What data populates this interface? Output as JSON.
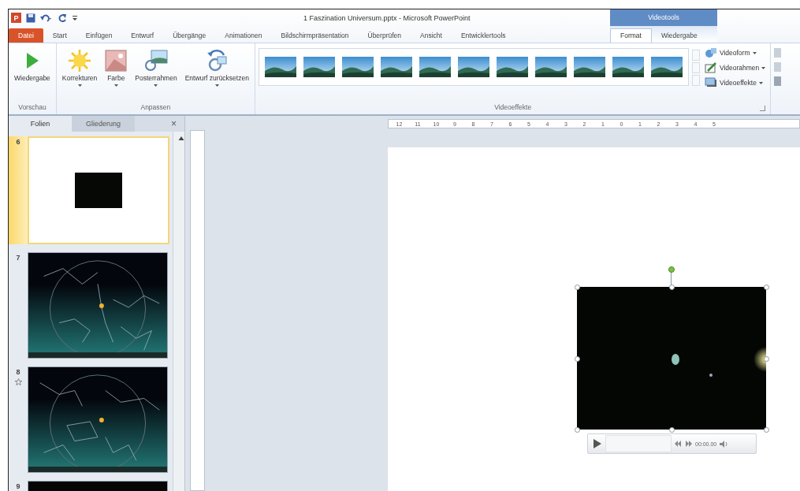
{
  "title_bar": {
    "logo_letter": "P",
    "title": "1 Faszination Universum.pptx - Microsoft PowerPoint",
    "contextual_header": "Videotools"
  },
  "ribbon_tabs": [
    {
      "label": "Datei",
      "kind": "file",
      "selected": false
    },
    {
      "label": "Start",
      "kind": "normal",
      "selected": false
    },
    {
      "label": "Einfügen",
      "kind": "normal",
      "selected": false
    },
    {
      "label": "Entwurf",
      "kind": "normal",
      "selected": false
    },
    {
      "label": "Übergänge",
      "kind": "normal",
      "selected": false
    },
    {
      "label": "Animationen",
      "kind": "normal",
      "selected": false
    },
    {
      "label": "Bildschirmpräsentation",
      "kind": "normal",
      "selected": false
    },
    {
      "label": "Überprüfen",
      "kind": "normal",
      "selected": false
    },
    {
      "label": "Ansicht",
      "kind": "normal",
      "selected": false
    },
    {
      "label": "Entwicklertools",
      "kind": "normal",
      "selected": false
    },
    {
      "label": "Format",
      "kind": "contextual",
      "selected": true
    },
    {
      "label": "Wiedergabe",
      "kind": "contextual",
      "selected": false
    }
  ],
  "ribbon_groups": [
    {
      "label": "Vorschau",
      "buttons": [
        {
          "label": "Wiedergabe",
          "kind": "play",
          "dropdown": false
        }
      ]
    },
    {
      "label": "Anpassen",
      "buttons": [
        {
          "label": "Korrekturen",
          "kind": "sun",
          "dropdown": true
        },
        {
          "label": "Farbe",
          "kind": "color",
          "dropdown": true
        },
        {
          "label": "Posterrahmen",
          "kind": "poster",
          "dropdown": true
        },
        {
          "label": "Entwurf zurücksetzen",
          "kind": "reset",
          "dropdown": true
        }
      ]
    },
    {
      "label": "Videoeffekte",
      "kind": "gallery",
      "side_buttons": [
        {
          "label": "Videoform",
          "kind": "shape"
        },
        {
          "label": "Videorahmen",
          "kind": "frame"
        },
        {
          "label": "Videoeffekte",
          "kind": "effects"
        }
      ]
    }
  ],
  "slide_pane": {
    "tabs": [
      {
        "label": "Folien",
        "selected": true
      },
      {
        "label": "Gliederung",
        "selected": false
      }
    ],
    "close": "×",
    "slides": [
      {
        "number": "6",
        "kind": "video",
        "selected": true,
        "animated": false
      },
      {
        "number": "7",
        "kind": "star_map",
        "selected": false,
        "animated": false
      },
      {
        "number": "8",
        "kind": "star_map",
        "selected": false,
        "animated": true
      },
      {
        "number": "9",
        "kind": "dark",
        "selected": false,
        "animated": false
      }
    ]
  },
  "ruler": {
    "labels": [
      "12",
      "11",
      "10",
      "9",
      "8",
      "7",
      "6",
      "5",
      "4",
      "3",
      "2",
      "1",
      "0",
      "1",
      "2",
      "3",
      "4",
      "5"
    ]
  },
  "video_controls": {
    "time": "00:00.00"
  }
}
